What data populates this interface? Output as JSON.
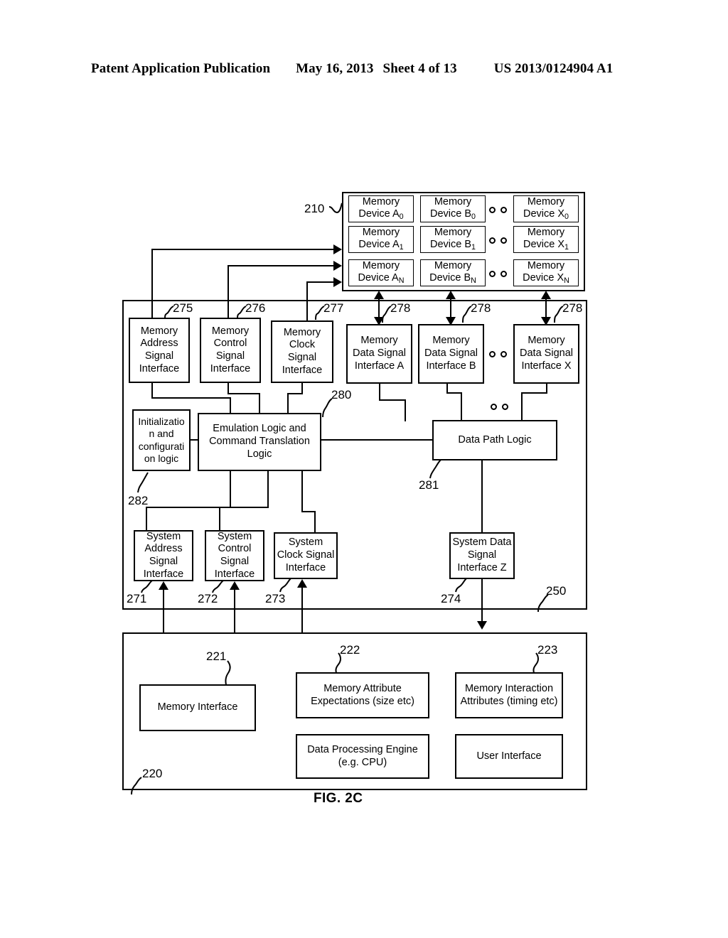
{
  "header": {
    "publication": "Patent Application Publication",
    "date": "May 16, 2013",
    "sheet": "Sheet 4 of 13",
    "patent_number": "US 2013/0124904 A1"
  },
  "figure": {
    "caption": "FIG. 2C",
    "ellipsis_glyph": "o o"
  },
  "memory_array": {
    "ref": "210",
    "devices": [
      {
        "label": "Memory Device A",
        "sub": "0"
      },
      {
        "label": "Memory Device B",
        "sub": "0"
      },
      {
        "label": "Memory Device X",
        "sub": "0"
      },
      {
        "label": "Memory Device A",
        "sub": "1"
      },
      {
        "label": "Memory Device B",
        "sub": "1"
      },
      {
        "label": "Memory Device X",
        "sub": "1"
      },
      {
        "label": "Memory Device A",
        "sub": "N"
      },
      {
        "label": "Memory Device B",
        "sub": "N"
      },
      {
        "label": "Memory Device X",
        "sub": "N"
      }
    ]
  },
  "emulator": {
    "ref": "250",
    "memory_side_interfaces": [
      {
        "label": "Memory Address Signal Interface",
        "ref": "275"
      },
      {
        "label": "Memory Control Signal Interface",
        "ref": "276"
      },
      {
        "label": "Memory Clock Signal Interface",
        "ref": "277"
      },
      {
        "label": "Memory Data Signal Interface A",
        "ref": "278"
      },
      {
        "label": "Memory Data Signal Interface B",
        "ref": "278"
      },
      {
        "label": "Memory Data Signal Interface X",
        "ref": "278"
      }
    ],
    "logic_blocks": [
      {
        "label": "Initializatio n and configurati on logic",
        "ref": "282"
      },
      {
        "label": "Emulation Logic and Command Translation Logic",
        "ref": "280"
      },
      {
        "label": "Data Path Logic",
        "ref": "281"
      }
    ],
    "system_side_interfaces": [
      {
        "label": "System Address Signal Interface",
        "ref": "271"
      },
      {
        "label": "System Control Signal Interface",
        "ref": "272"
      },
      {
        "label": "System Clock Signal Interface",
        "ref": "273"
      },
      {
        "label": "System Data Signal Interface Z",
        "ref": "274"
      }
    ]
  },
  "host_system": {
    "ref": "220",
    "blocks": [
      {
        "label": "Memory Interface",
        "ref": "221"
      },
      {
        "label": "Memory Attribute Expectations (size etc)",
        "ref": "222"
      },
      {
        "label": "Memory Interaction Attributes (timing etc)",
        "ref": "223"
      },
      {
        "label": "Data Processing Engine (e.g. CPU)",
        "ref": ""
      },
      {
        "label": "User Interface",
        "ref": ""
      }
    ]
  }
}
